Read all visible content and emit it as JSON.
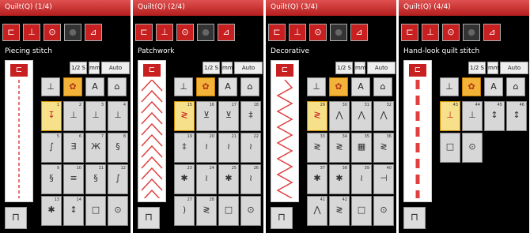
{
  "panels": [
    {
      "title": "Quilt(Q) (1/4)",
      "stitch_name": "Piecing stitch",
      "top_buttons": [
        "1/2 S",
        "mm",
        "Auto"
      ],
      "categories": [
        "pattern",
        "A",
        "garment"
      ],
      "preview": "dashed-line",
      "cells": [
        {
          "num": "1",
          "sym": "↧",
          "selected": true
        },
        {
          "num": "2",
          "sym": "⊥"
        },
        {
          "num": "3",
          "sym": "⊥"
        },
        {
          "num": "4",
          "sym": "⊥"
        },
        {
          "num": "5",
          "sym": "∫"
        },
        {
          "num": "6",
          "sym": "∃"
        },
        {
          "num": "7",
          "sym": "Ж"
        },
        {
          "num": "8",
          "sym": "§"
        },
        {
          "num": "9",
          "sym": "§"
        },
        {
          "num": "10",
          "sym": "≡"
        },
        {
          "num": "11",
          "sym": "§"
        },
        {
          "num": "12",
          "sym": "∫"
        },
        {
          "num": "13",
          "sym": "✱"
        },
        {
          "num": "14",
          "sym": "↕"
        },
        {
          "num": "",
          "sym": "□"
        },
        {
          "num": "",
          "sym": "⊙"
        }
      ]
    },
    {
      "title": "Quilt(Q) (2/4)",
      "stitch_name": "Patchwork",
      "top_buttons": [
        "1/2 S",
        "mm",
        "Auto"
      ],
      "categories": [
        "pattern",
        "A",
        "garment"
      ],
      "preview": "chevron",
      "cells": [
        {
          "num": "15",
          "sym": "≷",
          "selected": true
        },
        {
          "num": "16",
          "sym": "⊻"
        },
        {
          "num": "17",
          "sym": "⊻"
        },
        {
          "num": "18",
          "sym": "‡"
        },
        {
          "num": "19",
          "sym": "‡"
        },
        {
          "num": "20",
          "sym": "≀"
        },
        {
          "num": "21",
          "sym": "≀"
        },
        {
          "num": "22",
          "sym": "≀"
        },
        {
          "num": "23",
          "sym": "✱"
        },
        {
          "num": "24",
          "sym": "≀"
        },
        {
          "num": "25",
          "sym": "✱"
        },
        {
          "num": "26",
          "sym": "≀"
        },
        {
          "num": "27",
          "sym": ")"
        },
        {
          "num": "28",
          "sym": "≷"
        },
        {
          "num": "",
          "sym": "□"
        },
        {
          "num": "",
          "sym": "⊙"
        }
      ]
    },
    {
      "title": "Quilt(Q) (3/4)",
      "stitch_name": "Decorative",
      "top_buttons": [
        "1/2 S",
        "mm",
        "Auto"
      ],
      "categories": [
        "pattern",
        "A",
        "garment"
      ],
      "preview": "zigzag",
      "cells": [
        {
          "num": "29",
          "sym": "≷",
          "selected": true
        },
        {
          "num": "30",
          "sym": "⋀"
        },
        {
          "num": "31",
          "sym": "⋀"
        },
        {
          "num": "32",
          "sym": "⋀"
        },
        {
          "num": "33",
          "sym": "≷"
        },
        {
          "num": "34",
          "sym": "≷"
        },
        {
          "num": "35",
          "sym": "▦"
        },
        {
          "num": "36",
          "sym": "≷"
        },
        {
          "num": "37",
          "sym": "✱"
        },
        {
          "num": "38",
          "sym": "✱"
        },
        {
          "num": "39",
          "sym": "≀"
        },
        {
          "num": "40",
          "sym": "⊣"
        },
        {
          "num": "41",
          "sym": "⋀"
        },
        {
          "num": "42",
          "sym": "≷"
        },
        {
          "num": "",
          "sym": "□"
        },
        {
          "num": "",
          "sym": "⊙"
        }
      ]
    },
    {
      "title": "Quilt(Q) (4/4)",
      "stitch_name": "Hand-look quilt stitch",
      "top_buttons": [
        "1/2 S",
        "mm",
        "Auto"
      ],
      "categories": [
        "pattern",
        "A",
        "garment"
      ],
      "preview": "thick-dash",
      "cells": [
        {
          "num": "43",
          "sym": "⊥",
          "selected": true
        },
        {
          "num": "44",
          "sym": "⊥"
        },
        {
          "num": "45",
          "sym": "↕"
        },
        {
          "num": "46",
          "sym": "↕"
        },
        {
          "num": "",
          "sym": "□"
        },
        {
          "num": "",
          "sym": "⊙"
        }
      ]
    }
  ]
}
